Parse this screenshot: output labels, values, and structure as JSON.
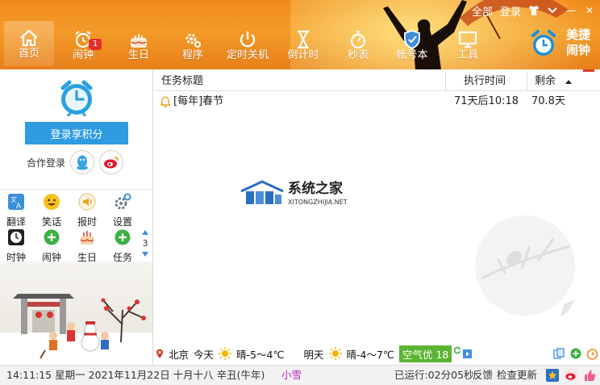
{
  "topbar": {
    "all_label": "全部",
    "login_label": "登录",
    "min_glyph": "—",
    "close_glyph": "✕"
  },
  "toolbar": {
    "items": [
      {
        "label": "首页",
        "icon": "home-icon"
      },
      {
        "label": "闹钟",
        "icon": "alarm-clock-icon",
        "badge": "1"
      },
      {
        "label": "生日",
        "icon": "birthday-cake-icon"
      },
      {
        "label": "程序",
        "icon": "gear-icon"
      },
      {
        "label": "定时关机",
        "icon": "power-icon"
      },
      {
        "label": "倒计时",
        "icon": "hourglass-icon"
      },
      {
        "label": "秒表",
        "icon": "stopwatch-icon"
      },
      {
        "label": "帐号本",
        "icon": "shield-icon"
      },
      {
        "label": "工具",
        "icon": "monitor-icon"
      }
    ],
    "brand_line1": "美捷",
    "brand_line2": "闹钟"
  },
  "left": {
    "login_button": "登录享积分",
    "coop_label": "合作登录",
    "grid": [
      {
        "label": "翻译",
        "icon": "translate-icon"
      },
      {
        "label": "笑话",
        "icon": "smiley-icon"
      },
      {
        "label": "报时",
        "icon": "speaker-icon"
      },
      {
        "label": "设置",
        "icon": "gear-icon"
      },
      {
        "label": "时钟",
        "icon": "clock-icon"
      },
      {
        "label": "闹钟",
        "icon": "add-icon"
      },
      {
        "label": "生日",
        "icon": "cake-icon"
      },
      {
        "label": "任务",
        "icon": "add-icon"
      }
    ],
    "page_number": "3"
  },
  "table": {
    "col_title": "任务标题",
    "col_time": "执行时间",
    "col_remain": "剩余",
    "rows": [
      {
        "title": "[每年]春节",
        "time": "71天后10:18",
        "remain": "70.8天"
      }
    ]
  },
  "watermark": {
    "name": "系统之家",
    "url": "XITONGZHIJIA.NET"
  },
  "weather": {
    "city": "北京",
    "today_label": "今天",
    "today_desc": "晴-5～4℃",
    "tomorrow_label": "明天",
    "tomorrow_desc": "晴-4～7℃",
    "aqi": "空气优 18"
  },
  "status": {
    "datetime": "14:11:15 星期一 2021年11月22日 十月十八 辛丑(牛年)",
    "solar_term": "小雪",
    "uptime": "已运行:02分05秒",
    "feedback": "反馈",
    "update": "检查更新"
  },
  "colors": {
    "toolbar_orange": "#f39a28",
    "login_blue": "#2f9be0",
    "solar_term_purple": "#c020c0",
    "aqi_green": "#5cb531"
  }
}
